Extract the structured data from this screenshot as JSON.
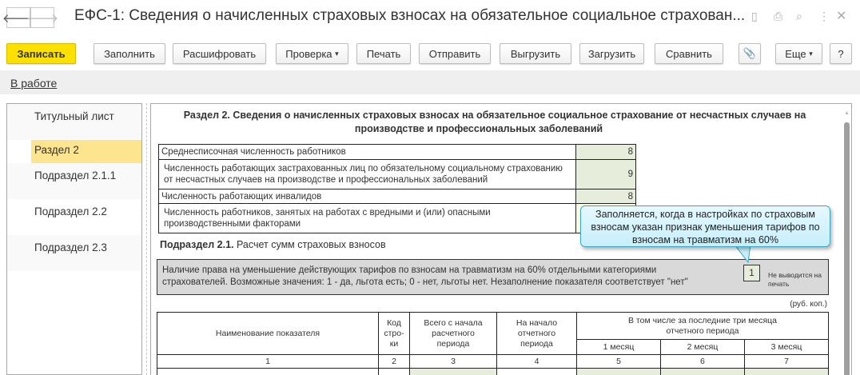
{
  "window": {
    "title": "ЕФС-1: Сведения о начисленных страховых взносах на обязательное социальное страхован...",
    "back_icon": "arrow-left",
    "forward_icon": "arrow-right"
  },
  "toolbar": {
    "buttons": [
      "Записать",
      "Заполнить",
      "Расшифровать",
      "Проверка",
      "Печать",
      "Отправить",
      "Выгрузить",
      "Загрузить",
      "Сравнить"
    ],
    "more": "Еще",
    "help": "?",
    "dropdown_glyph": "▾"
  },
  "status": {
    "label": "В работе"
  },
  "sidebar": {
    "items": [
      "Титульный лист",
      "Раздел 2",
      "Подраздел 2.1.1",
      "Подраздел 2.2",
      "Подраздел 2.3"
    ],
    "selected": "Раздел 2",
    "selected_color": "#fde48e"
  },
  "section": {
    "title_line1": "Раздел 2. Сведения о начисленных страховых взносах на обязательное социальное страхование от несчастных случаев на",
    "title_line2": "производстве и профессиональных заболеваний",
    "rows": [
      {
        "label": "Среднесписочная численность работников",
        "value": "8"
      },
      {
        "label": "Численность работающих застрахованных лиц по обязательному социальному страхованию от несчастных случаев на производстве и профессиональных заболеваний",
        "value": "9"
      },
      {
        "label": "Численность работающих инвалидов",
        "value": "8"
      },
      {
        "label": "Численность работников, занятых на работах с вредными и (или) опасными производственными факторами",
        "value": ""
      }
    ]
  },
  "callout": {
    "text": "Заполняется, когда в настройках по страховым взносам указан признак уменьшения тарифов по взносам на травматизм на 60%"
  },
  "subsection": {
    "title_bold": "Подраздел 2.1.",
    "title_rest": " Расчет сумм страховых взносов",
    "right_text": "Наличие права на уменьшение действующих тарифов по взносам на травматизм на 60% отдельными категориями страхователей. Возможные значения: 1 - да, льгота есть; 0 - нет, льготы нет. Незаполнение показателя соответствует \"нет\"",
    "right_value": "1",
    "no_print": "Не выводится на печать",
    "units": "(руб. коп.)"
  },
  "table": {
    "headers": [
      "Наименование показателя",
      "Код стро-ки",
      "Всего с начала расчетного периода",
      "На начало отчетного периода",
      "В том числе за последние три месяца отчетного периода"
    ],
    "months": [
      "1 месяц",
      "2 месяц",
      "3 месяц"
    ],
    "numbers": [
      "1",
      "2",
      "3",
      "4",
      "5",
      "6",
      "7"
    ]
  }
}
